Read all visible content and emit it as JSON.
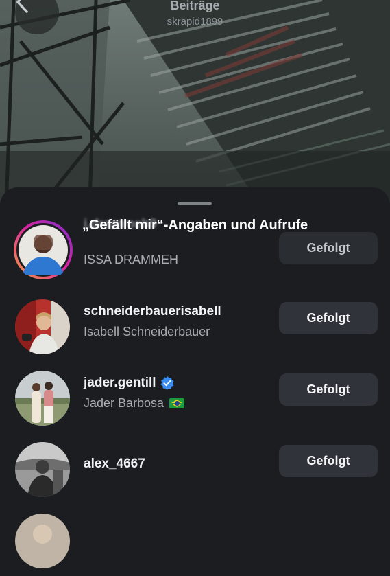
{
  "header": {
    "title": "Beiträge",
    "subtitle": "skrapid1899"
  },
  "sheet": {
    "title": "„Gefällt mir“-Angaben und Aufrufe"
  },
  "accounts": [
    {
      "username": "i.drammeh9",
      "name": "ISSA DRAMMEH",
      "button": "Gefolgt",
      "verified": false
    },
    {
      "username": "schneiderbauerisabell",
      "name": "Isabell Schneiderbauer",
      "button": "Gefolgt",
      "verified": false
    },
    {
      "username": "jader.gentill",
      "name": "Jader Barbosa",
      "button": "Gefolgt",
      "verified": true,
      "flag": "brazil-flag-icon"
    },
    {
      "username": "alex_4667",
      "name": "",
      "button": "Gefolgt",
      "verified": false
    }
  ],
  "colors": {
    "background": "#1b1d21",
    "button": "#303339",
    "verified": "#3b8df0",
    "story_ring": [
      "#f9a03f",
      "#d6249f",
      "#7d2fd0"
    ]
  }
}
